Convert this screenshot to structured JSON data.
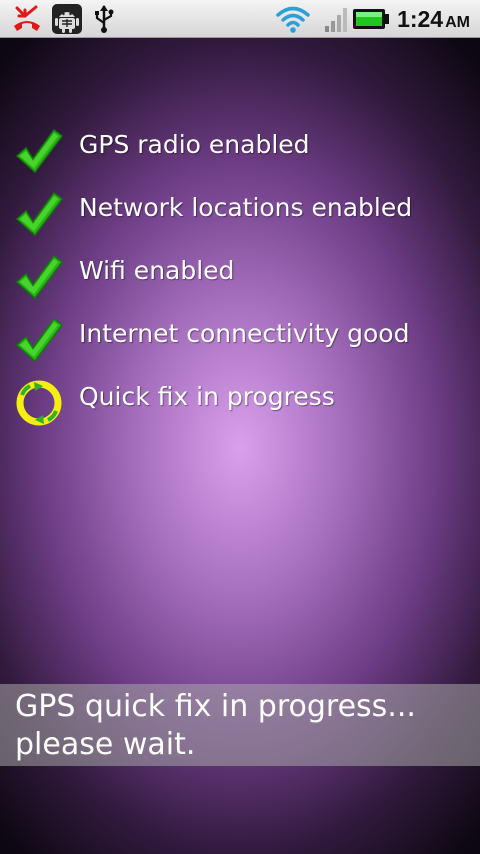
{
  "status_bar": {
    "icons": [
      "missed-call-icon",
      "android-debug-icon",
      "usb-icon",
      "wifi-icon",
      "signal-icon",
      "battery-icon"
    ],
    "time": "1:24",
    "ampm": "AM"
  },
  "checklist": {
    "items": [
      {
        "label": "GPS radio enabled",
        "state": "done",
        "icon": "check-icon"
      },
      {
        "label": "Network locations enabled",
        "state": "done",
        "icon": "check-icon"
      },
      {
        "label": "Wifi enabled",
        "state": "done",
        "icon": "check-icon"
      },
      {
        "label": "Internet connectivity good",
        "state": "done",
        "icon": "check-icon"
      },
      {
        "label": "Quick fix in progress",
        "state": "in-progress",
        "icon": "sync-progress-icon"
      }
    ]
  },
  "banner": {
    "line1": "GPS quick fix in progress...",
    "line2": "please wait."
  },
  "colors": {
    "check_green": "#2bb515",
    "progress_yellow": "#f4ef10",
    "progress_green": "#2db22a",
    "background_center": "#d9a0ec",
    "background_edge": "#0c0710"
  }
}
